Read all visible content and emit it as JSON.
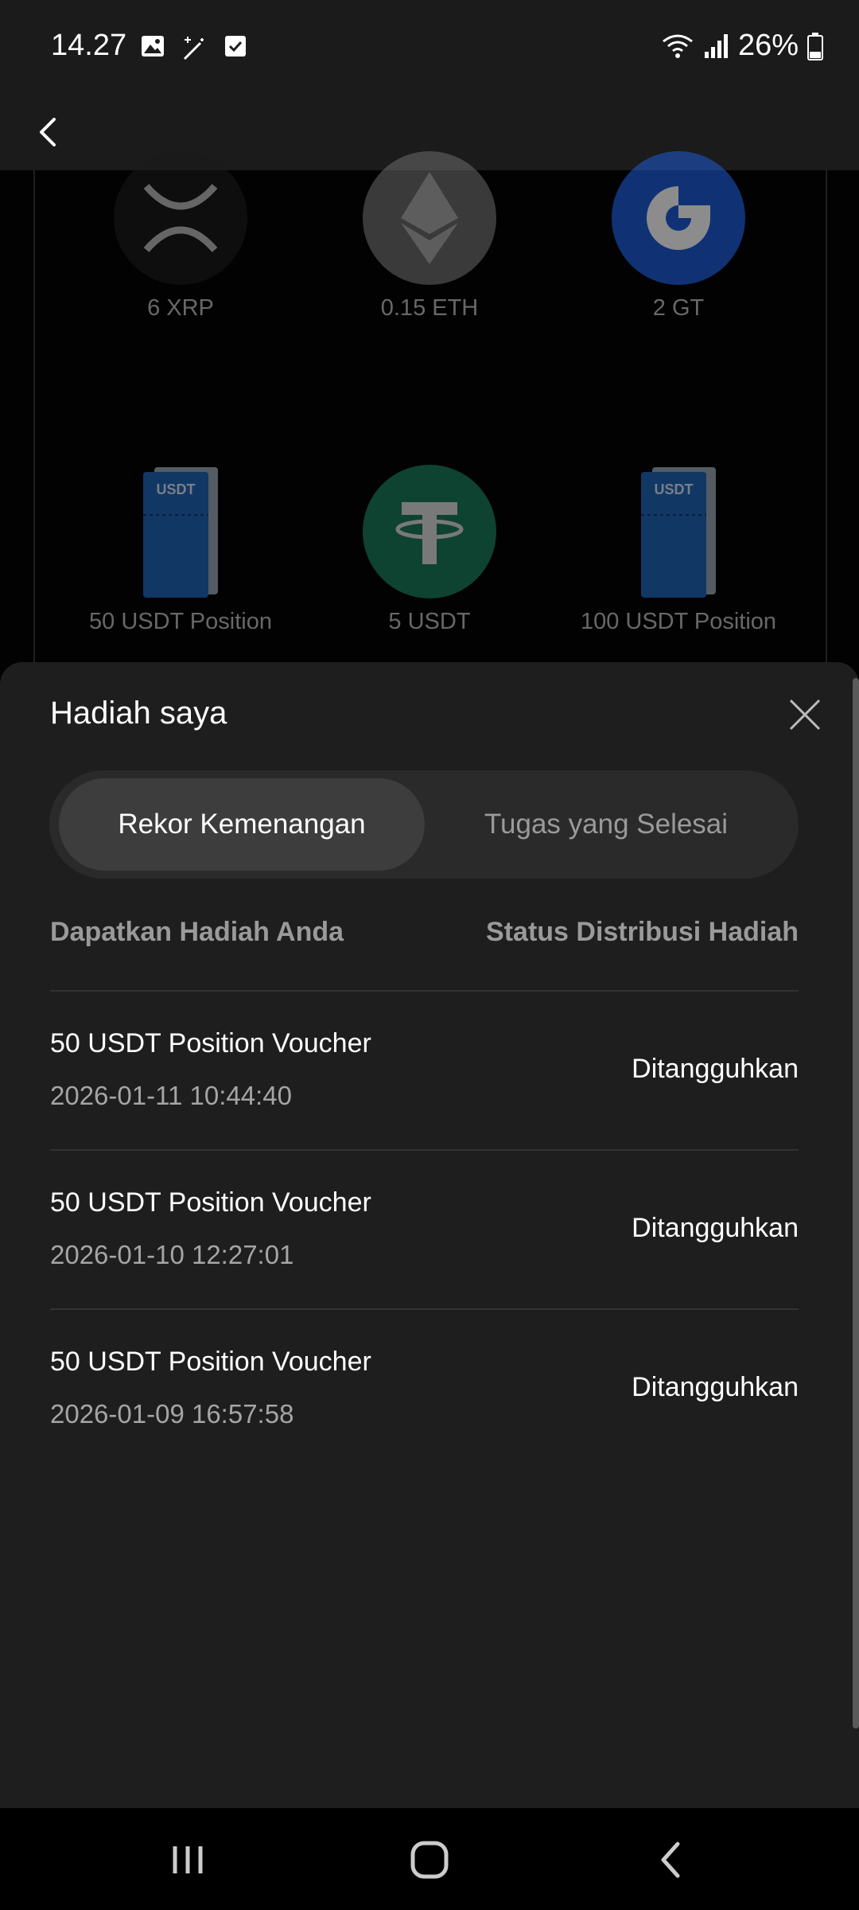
{
  "status_bar": {
    "time": "14.27",
    "battery": "26%",
    "icons_left": [
      "image-icon",
      "magic-wand-icon",
      "checkbox-icon"
    ],
    "icons_right": [
      "wifi-icon",
      "signal-icon",
      "battery-icon"
    ]
  },
  "app_bar": {
    "back_icon": "chevron-left-icon"
  },
  "background_prizes": [
    {
      "label": "6 XRP",
      "icon": "xrp-icon",
      "color": "#1a1a1a"
    },
    {
      "label": "0.15 ETH",
      "icon": "eth-icon",
      "color": "#6b6b6b"
    },
    {
      "label": "2 GT",
      "icon": "gt-icon",
      "color": "#1e5cd6"
    },
    {
      "label": "50 USDT Position",
      "icon": "voucher-icon",
      "color": "#1f64b8"
    },
    {
      "label": "5 USDT",
      "icon": "usdt-icon",
      "color": "#1d7a5a"
    },
    {
      "label": "100 USDT Position",
      "icon": "voucher-icon",
      "color": "#1f64b8"
    }
  ],
  "voucher_badge": "USDT",
  "sheet": {
    "title": "Hadiah saya",
    "close_icon": "close-icon",
    "tabs": [
      {
        "label": "Rekor Kemenangan",
        "active": true
      },
      {
        "label": "Tugas yang Selesai",
        "active": false
      }
    ],
    "columns": {
      "left": "Dapatkan Hadiah Anda",
      "right": "Status Distribusi Hadiah"
    },
    "rows": [
      {
        "title": "50 USDT Position Voucher",
        "date": "2026-01-11 10:44:40",
        "status": "Ditangguhkan"
      },
      {
        "title": "50 USDT Position Voucher",
        "date": "2026-01-10 12:27:01",
        "status": "Ditangguhkan"
      },
      {
        "title": "50 USDT Position Voucher",
        "date": "2026-01-09 16:57:58",
        "status": "Ditangguhkan"
      }
    ]
  },
  "nav_bar": {
    "icons": [
      "recents-icon",
      "home-icon",
      "back-icon"
    ]
  }
}
